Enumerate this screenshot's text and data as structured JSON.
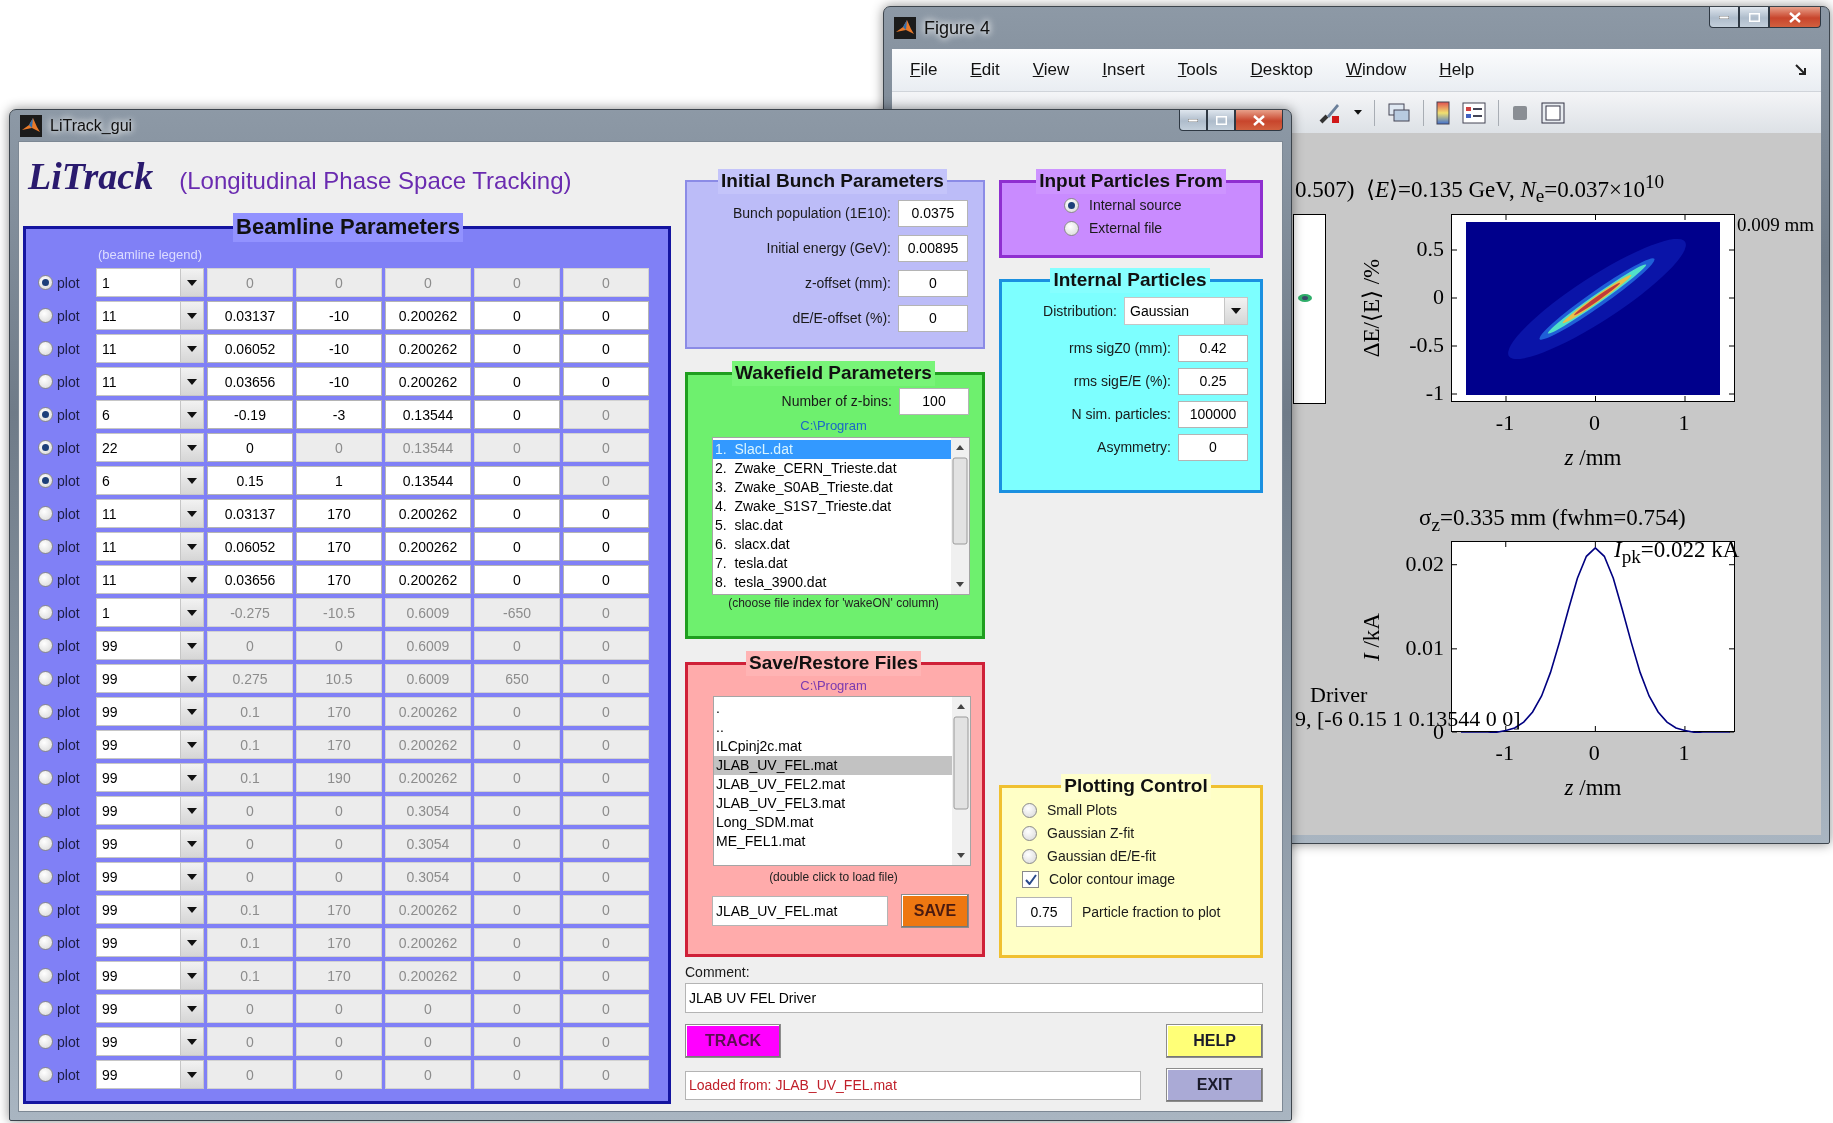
{
  "figure_window": {
    "title": "Figure 4",
    "menu": [
      "File",
      "Edit",
      "View",
      "Insert",
      "Tools",
      "Desktop",
      "Window",
      "Help"
    ],
    "energy_title": "0.507)  ⟨*E*⟩=0.135 GeV, *N*$_{e}$=0.037×10$^{10}$",
    "offset_note": "0.009 mm",
    "phase_plot": {
      "xlabel": "*z* /mm",
      "ylabel": "ΔE/⟨E⟩ /%",
      "xticks": [
        "-1",
        "0",
        "1"
      ],
      "yticks": [
        "0.5",
        "0",
        "-0.5",
        "-1"
      ]
    },
    "current_plot": {
      "title": "σ$_{z}$=0.335 mm (fwhm=0.754)",
      "annotation": "*I*$_{pk}$=0.022 kA",
      "chart_data": {
        "type": "line",
        "xlabel": "z /mm",
        "ylabel": "I /kA",
        "xlim": [
          -1.6,
          1.57
        ],
        "ylim": [
          0,
          0.0227
        ],
        "xticks": [
          -1,
          0,
          1
        ],
        "yticks": [
          0,
          0.01,
          0.02
        ],
        "x": [
          -1.5,
          -1.4,
          -1.3,
          -1.2,
          -1.1,
          -1.0,
          -0.9,
          -0.8,
          -0.7,
          -0.6,
          -0.5,
          -0.4,
          -0.3,
          -0.2,
          -0.1,
          0,
          0.1,
          0.2,
          0.3,
          0.4,
          0.5,
          0.6,
          0.7,
          0.8,
          0.9,
          1.0,
          1.1,
          1.2,
          1.3,
          1.4,
          1.5
        ],
        "series": [
          {
            "color": "#000080",
            "values": [
              0,
              0,
              0,
              0,
              0.0001,
              0.0003,
              0.0006,
              0.0013,
              0.0025,
              0.0044,
              0.0072,
              0.0108,
              0.0147,
              0.0184,
              0.021,
              0.022,
              0.021,
              0.0184,
              0.0147,
              0.0108,
              0.0072,
              0.0044,
              0.0025,
              0.0013,
              0.0006,
              0.0003,
              0.0001,
              0,
              0,
              0,
              0
            ]
          }
        ]
      }
    },
    "overlay_texts": [
      "Driver",
      "9, [-6 0.15 1 0.13544 0 0]"
    ]
  },
  "litrack_window": {
    "title": "LiTrack_gui",
    "logo": "LiTrack",
    "subtitle": "(Longitudinal Phase Space Tracking)",
    "beamline": {
      "title": "Beamline Parameters",
      "legend": "(beamline legend)",
      "rows": [
        {
          "selected": true,
          "label": "plot",
          "code": "1",
          "cells": [
            "0",
            "0",
            "0",
            "0",
            "0"
          ],
          "disabled": [
            true,
            true,
            true,
            true,
            true
          ]
        },
        {
          "selected": false,
          "label": "plot",
          "code": "11",
          "cells": [
            "0.03137",
            "-10",
            "0.200262",
            "0",
            "0"
          ],
          "disabled": [
            false,
            false,
            false,
            false,
            false
          ]
        },
        {
          "selected": false,
          "label": "plot",
          "code": "11",
          "cells": [
            "0.06052",
            "-10",
            "0.200262",
            "0",
            "0"
          ],
          "disabled": [
            false,
            false,
            false,
            false,
            false
          ]
        },
        {
          "selected": false,
          "label": "plot",
          "code": "11",
          "cells": [
            "0.03656",
            "-10",
            "0.200262",
            "0",
            "0"
          ],
          "disabled": [
            false,
            false,
            false,
            false,
            false
          ]
        },
        {
          "selected": true,
          "label": "plot",
          "code": "6",
          "cells": [
            "-0.19",
            "-3",
            "0.13544",
            "0",
            "0"
          ],
          "disabled": [
            false,
            false,
            false,
            false,
            true
          ]
        },
        {
          "selected": true,
          "label": "plot",
          "code": "22",
          "cells": [
            "0",
            "0",
            "0.13544",
            "0",
            "0"
          ],
          "disabled": [
            false,
            true,
            true,
            true,
            true
          ]
        },
        {
          "selected": true,
          "label": "plot",
          "code": "6",
          "cells": [
            "0.15",
            "1",
            "0.13544",
            "0",
            "0"
          ],
          "disabled": [
            false,
            false,
            false,
            false,
            true
          ]
        },
        {
          "selected": false,
          "label": "plot",
          "code": "11",
          "cells": [
            "0.03137",
            "170",
            "0.200262",
            "0",
            "0"
          ],
          "disabled": [
            false,
            false,
            false,
            false,
            false
          ]
        },
        {
          "selected": false,
          "label": "plot",
          "code": "11",
          "cells": [
            "0.06052",
            "170",
            "0.200262",
            "0",
            "0"
          ],
          "disabled": [
            false,
            false,
            false,
            false,
            false
          ]
        },
        {
          "selected": false,
          "label": "plot",
          "code": "11",
          "cells": [
            "0.03656",
            "170",
            "0.200262",
            "0",
            "0"
          ],
          "disabled": [
            false,
            false,
            false,
            false,
            false
          ]
        },
        {
          "selected": false,
          "label": "plot",
          "code": "1",
          "cells": [
            "-0.275",
            "-10.5",
            "0.6009",
            "-650",
            "0"
          ],
          "disabled": [
            true,
            true,
            true,
            true,
            true
          ]
        },
        {
          "selected": false,
          "label": "plot",
          "code": "99",
          "cells": [
            "0",
            "0",
            "0.6009",
            "0",
            "0"
          ],
          "disabled": [
            true,
            true,
            true,
            true,
            true
          ]
        },
        {
          "selected": false,
          "label": "plot",
          "code": "99",
          "cells": [
            "0.275",
            "10.5",
            "0.6009",
            "650",
            "0"
          ],
          "disabled": [
            true,
            true,
            true,
            true,
            true
          ]
        },
        {
          "selected": false,
          "label": "plot",
          "code": "99",
          "cells": [
            "0.1",
            "170",
            "0.200262",
            "0",
            "0"
          ],
          "disabled": [
            true,
            true,
            true,
            true,
            true
          ]
        },
        {
          "selected": false,
          "label": "plot",
          "code": "99",
          "cells": [
            "0.1",
            "170",
            "0.200262",
            "0",
            "0"
          ],
          "disabled": [
            true,
            true,
            true,
            true,
            true
          ]
        },
        {
          "selected": false,
          "label": "plot",
          "code": "99",
          "cells": [
            "0.1",
            "190",
            "0.200262",
            "0",
            "0"
          ],
          "disabled": [
            true,
            true,
            true,
            true,
            true
          ]
        },
        {
          "selected": false,
          "label": "plot",
          "code": "99",
          "cells": [
            "0",
            "0",
            "0.3054",
            "0",
            "0"
          ],
          "disabled": [
            true,
            true,
            true,
            true,
            true
          ]
        },
        {
          "selected": false,
          "label": "plot",
          "code": "99",
          "cells": [
            "0",
            "0",
            "0.3054",
            "0",
            "0"
          ],
          "disabled": [
            true,
            true,
            true,
            true,
            true
          ]
        },
        {
          "selected": false,
          "label": "plot",
          "code": "99",
          "cells": [
            "0",
            "0",
            "0.3054",
            "0",
            "0"
          ],
          "disabled": [
            true,
            true,
            true,
            true,
            true
          ]
        },
        {
          "selected": false,
          "label": "plot",
          "code": "99",
          "cells": [
            "0.1",
            "170",
            "0.200262",
            "0",
            "0"
          ],
          "disabled": [
            true,
            true,
            true,
            true,
            true
          ]
        },
        {
          "selected": false,
          "label": "plot",
          "code": "99",
          "cells": [
            "0.1",
            "170",
            "0.200262",
            "0",
            "0"
          ],
          "disabled": [
            true,
            true,
            true,
            true,
            true
          ]
        },
        {
          "selected": false,
          "label": "plot",
          "code": "99",
          "cells": [
            "0.1",
            "170",
            "0.200262",
            "0",
            "0"
          ],
          "disabled": [
            true,
            true,
            true,
            true,
            true
          ]
        },
        {
          "selected": false,
          "label": "plot",
          "code": "99",
          "cells": [
            "0",
            "0",
            "0",
            "0",
            "0"
          ],
          "disabled": [
            true,
            true,
            true,
            true,
            true
          ]
        },
        {
          "selected": false,
          "label": "plot",
          "code": "99",
          "cells": [
            "0",
            "0",
            "0",
            "0",
            "0"
          ],
          "disabled": [
            true,
            true,
            true,
            true,
            true
          ]
        },
        {
          "selected": false,
          "label": "plot",
          "code": "99",
          "cells": [
            "0",
            "0",
            "0",
            "0",
            "0"
          ],
          "disabled": [
            true,
            true,
            true,
            true,
            true
          ]
        }
      ]
    },
    "bunch": {
      "title": "Initial Bunch Parameters",
      "fields": [
        {
          "label": "Bunch population (1E10):",
          "value": "0.0375"
        },
        {
          "label": "Initial energy (GeV):",
          "value": "0.00895"
        },
        {
          "label": "z-offset (mm):",
          "value": "0"
        },
        {
          "label": "dE/E-offset (%):",
          "value": "0"
        }
      ]
    },
    "wakefield": {
      "title": "Wakefield Parameters",
      "bins_label": "Number of z-bins:",
      "bins_value": "100",
      "path": "C:\\Program",
      "files": [
        {
          "label": "1.  SlacL.dat",
          "selected": true
        },
        {
          "label": "2.  Zwake_CERN_Trieste.dat",
          "selected": false
        },
        {
          "label": "3.  Zwake_S0AB_Trieste.dat",
          "selected": false
        },
        {
          "label": "4.  Zwake_S1S7_Trieste.dat",
          "selected": false
        },
        {
          "label": "5.  slac.dat",
          "selected": false
        },
        {
          "label": "6.  slacx.dat",
          "selected": false
        },
        {
          "label": "7.  tesla.dat",
          "selected": false
        },
        {
          "label": "8.  tesla_3900.dat",
          "selected": false
        }
      ],
      "hint": "(choose file index for 'wakeON' column)"
    },
    "save": {
      "title": "Save/Restore Files",
      "path": "C:\\Program",
      "files": [
        {
          "label": ".",
          "selected": false
        },
        {
          "label": "..",
          "selected": false
        },
        {
          "label": "ILCpinj2c.mat",
          "selected": false
        },
        {
          "label": "JLAB_UV_FEL.mat",
          "selected": true
        },
        {
          "label": "JLAB_UV_FEL2.mat",
          "selected": false
        },
        {
          "label": "JLAB_UV_FEL3.mat",
          "selected": false
        },
        {
          "label": "Long_SDM.mat",
          "selected": false
        },
        {
          "label": "ME_FEL1.mat",
          "selected": false
        }
      ],
      "hint": "(double click to load file)",
      "filename": "JLAB_UV_FEL.mat",
      "save_button": "SAVE"
    },
    "input_source": {
      "title": "Input Particles From",
      "options": [
        {
          "label": "Internal source",
          "selected": true
        },
        {
          "label": "External file",
          "selected": false
        }
      ]
    },
    "internal": {
      "title": "Internal Particles",
      "distribution_label": "Distribution:",
      "distribution": "Gaussian",
      "fields": [
        {
          "label": "rms sigZ0 (mm):",
          "value": "0.42"
        },
        {
          "label": "rms sigE/E (%):",
          "value": "0.25"
        },
        {
          "label": "N sim. particles:",
          "value": "100000"
        },
        {
          "label": "Asymmetry:",
          "value": "0"
        }
      ]
    },
    "plotting": {
      "title": "Plotting Control",
      "options": [
        {
          "kind": "radio",
          "label": "Small Plots",
          "selected": false
        },
        {
          "kind": "radio",
          "label": "Gaussian Z-fit",
          "selected": false
        },
        {
          "kind": "radio",
          "label": "Gaussian dE/E-fit",
          "selected": false
        },
        {
          "kind": "checkbox",
          "label": "Color contour image",
          "checked": true
        }
      ],
      "fraction": "0.75",
      "fraction_label": "Particle fraction to plot"
    },
    "comment_label": "Comment:",
    "comment": "JLAB UV FEL Driver",
    "track_button": "TRACK",
    "status": "Loaded from: JLAB_UV_FEL.mat",
    "help_button": "HELP",
    "exit_button": "EXIT"
  }
}
